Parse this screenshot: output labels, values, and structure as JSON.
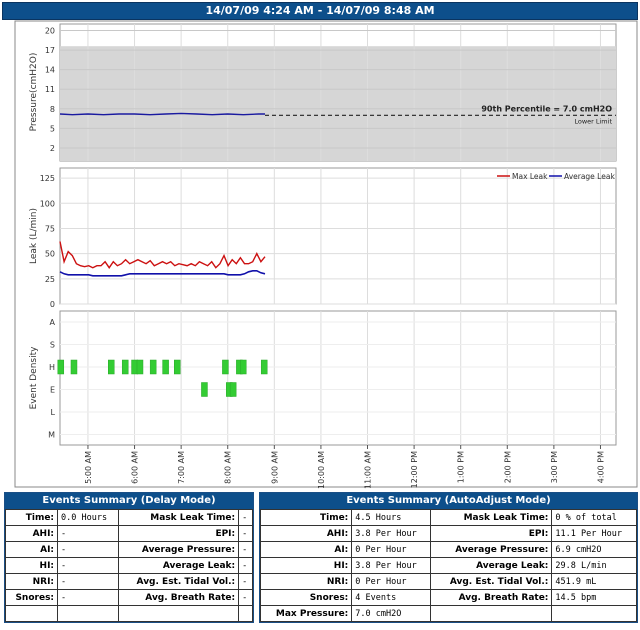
{
  "header": {
    "title": "14/07/09 4:24 AM - 14/07/09 8:48 AM"
  },
  "chart_data": [
    {
      "type": "line",
      "ylabel": "Pressure(cmH2O)",
      "ylim": [
        0,
        21
      ],
      "yticks": [
        2,
        5,
        8,
        11,
        14,
        17,
        20
      ],
      "shaded_band": [
        0,
        17.6
      ],
      "series": [
        {
          "name": "",
          "x": [
            "04:24",
            "04:40",
            "05:00",
            "05:20",
            "05:40",
            "06:00",
            "06:20",
            "06:40",
            "07:00",
            "07:20",
            "07:40",
            "08:00",
            "08:20",
            "08:40",
            "08:48"
          ],
          "values": [
            7.2,
            7.1,
            7.2,
            7.1,
            7.2,
            7.2,
            7.1,
            7.2,
            7.3,
            7.2,
            7.1,
            7.2,
            7.1,
            7.2,
            7.2
          ]
        }
      ],
      "reference_line": {
        "value": 7.0,
        "label": "90th Percentile = 7.0 cmH2O",
        "sublabel": "Lower Limit"
      }
    },
    {
      "type": "line",
      "ylabel": "Leak (L/min)",
      "ylim": [
        0,
        135
      ],
      "yticks": [
        0,
        25,
        50,
        75,
        100,
        125
      ],
      "legend": "top-right",
      "series": [
        {
          "name": "Max Leak",
          "color": "#cc1111",
          "values": [
            62,
            42,
            52,
            48,
            40,
            38,
            37,
            38,
            36,
            38,
            38,
            42,
            36,
            42,
            38,
            40,
            44,
            40,
            42,
            44,
            42,
            40,
            43,
            38,
            40,
            42,
            40,
            42,
            38,
            40,
            39,
            38,
            40,
            38,
            42,
            40,
            38,
            42,
            36,
            40,
            48,
            38,
            44,
            40,
            46,
            40,
            40,
            42,
            50,
            42,
            47
          ]
        },
        {
          "name": "Average Leak",
          "color": "#1111aa",
          "values": [
            32,
            30,
            29,
            29,
            29,
            29,
            29,
            29,
            28,
            28,
            28,
            28,
            28,
            28,
            28,
            28,
            29,
            30,
            30,
            30,
            30,
            30,
            30,
            30,
            30,
            30,
            30,
            30,
            30,
            30,
            30,
            30,
            30,
            30,
            30,
            30,
            30,
            30,
            30,
            30,
            30,
            29,
            29,
            29,
            29,
            30,
            32,
            33,
            33,
            31,
            30
          ]
        }
      ]
    },
    {
      "type": "scatter",
      "ylabel": "Event Density",
      "ycategories": [
        "A",
        "S",
        "H",
        "E",
        "L",
        "M"
      ],
      "events": [
        {
          "cat": "H",
          "time": "04:25"
        },
        {
          "cat": "H",
          "time": "04:42"
        },
        {
          "cat": "H",
          "time": "05:30"
        },
        {
          "cat": "H",
          "time": "05:48"
        },
        {
          "cat": "H",
          "time": "06:00"
        },
        {
          "cat": "H",
          "time": "06:07"
        },
        {
          "cat": "H",
          "time": "06:24"
        },
        {
          "cat": "H",
          "time": "06:40"
        },
        {
          "cat": "H",
          "time": "06:55"
        },
        {
          "cat": "H",
          "time": "07:57"
        },
        {
          "cat": "H",
          "time": "08:15"
        },
        {
          "cat": "H",
          "time": "08:20"
        },
        {
          "cat": "H",
          "time": "08:47"
        },
        {
          "cat": "E",
          "time": "07:30"
        },
        {
          "cat": "E",
          "time": "08:02"
        },
        {
          "cat": "E",
          "time": "08:07"
        }
      ],
      "color": "#33cc33"
    }
  ],
  "xaxis": {
    "ticks": [
      "5:00 AM",
      "6:00 AM",
      "7:00 AM",
      "8:00 AM",
      "9:00 AM",
      "10:00 AM",
      "11:00 AM",
      "12:00 PM",
      "1:00 PM",
      "2:00 PM",
      "3:00 PM",
      "4:00 PM"
    ]
  },
  "delay_summary": {
    "title": "Events Summary (Delay Mode)",
    "rows": [
      [
        "Time:",
        "0.0 Hours",
        "Mask Leak Time:",
        "-"
      ],
      [
        "AHI:",
        "-",
        "EPI:",
        "-"
      ],
      [
        "AI:",
        "-",
        "Average Pressure:",
        "-"
      ],
      [
        "HI:",
        "-",
        "Average Leak:",
        "-"
      ],
      [
        "NRI:",
        "-",
        "Avg. Est. Tidal Vol.:",
        "-"
      ],
      [
        "Snores:",
        "-",
        "Avg. Breath Rate:",
        "-"
      ],
      [
        "",
        "",
        "",
        ""
      ]
    ]
  },
  "auto_summary": {
    "title": "Events Summary (AutoAdjust Mode)",
    "rows": [
      [
        "Time:",
        "4.5 Hours",
        "Mask Leak Time:",
        "0 % of total"
      ],
      [
        "AHI:",
        "3.8 Per Hour",
        "EPI:",
        "11.1 Per Hour"
      ],
      [
        "AI:",
        "0 Per Hour",
        "Average Pressure:",
        "6.9 cmH2O"
      ],
      [
        "HI:",
        "3.8 Per Hour",
        "Average Leak:",
        "29.8 L/min"
      ],
      [
        "NRI:",
        "0 Per Hour",
        "Avg. Est. Tidal Vol.:",
        "451.9 mL"
      ],
      [
        "Snores:",
        "4 Events",
        "Avg. Breath Rate:",
        "14.5 bpm"
      ],
      [
        "Max Pressure:",
        "7.0 cmH2O",
        "",
        ""
      ]
    ]
  }
}
